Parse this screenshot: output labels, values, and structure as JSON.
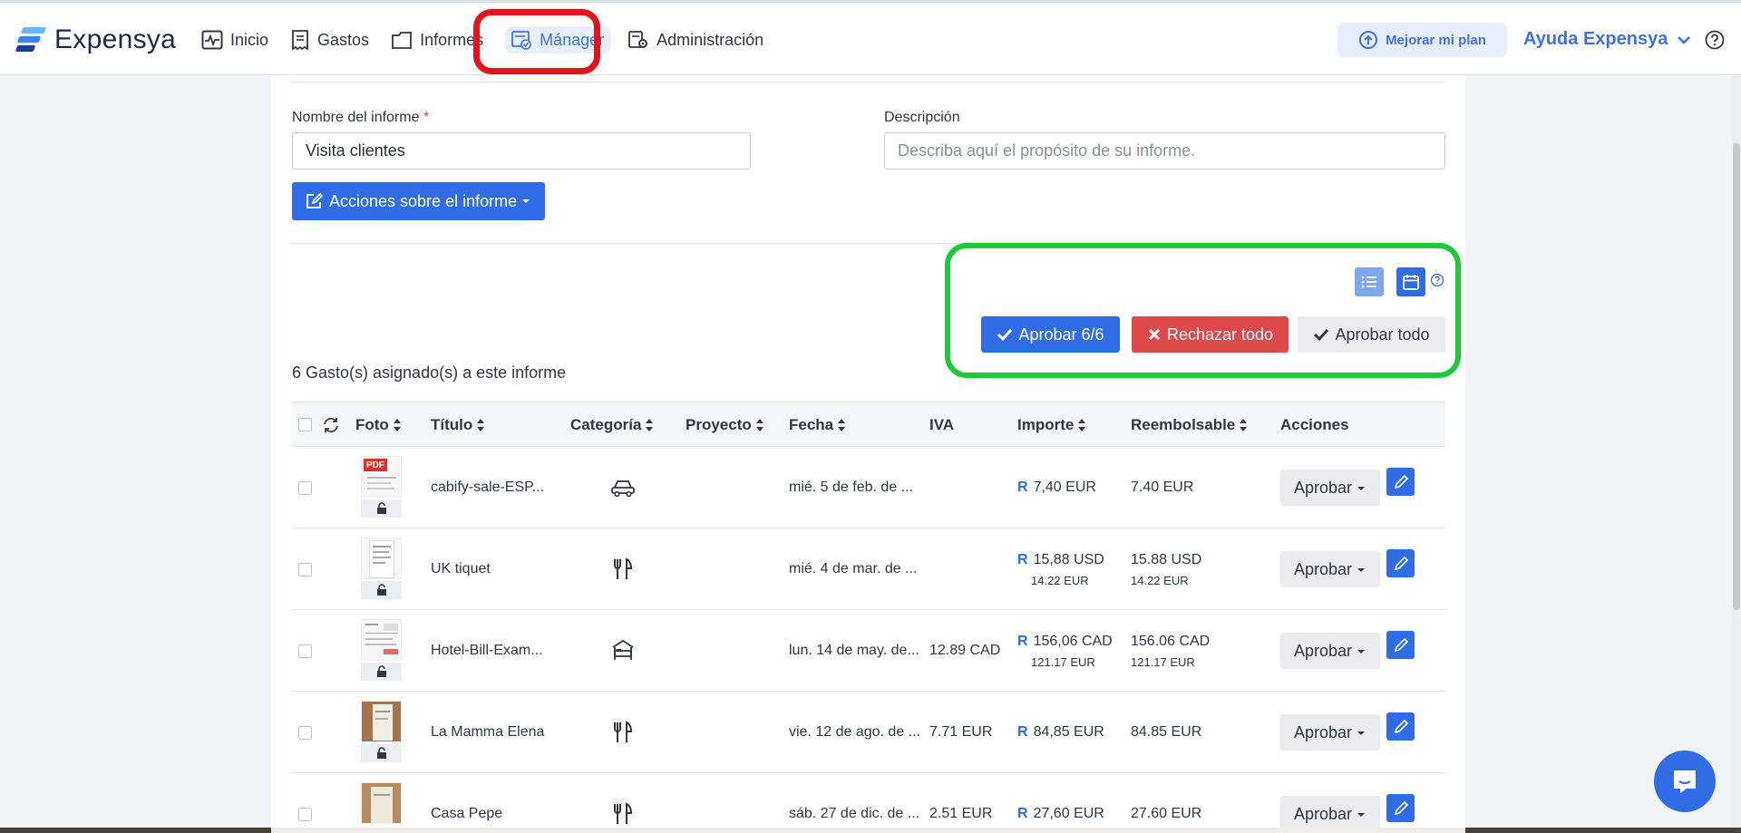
{
  "app": {
    "name": "Expensya",
    "brand_color": "#2f6ce6"
  },
  "nav": {
    "items": [
      {
        "label": "Inicio",
        "icon": "activity-icon"
      },
      {
        "label": "Gastos",
        "icon": "receipt-icon"
      },
      {
        "label": "Informes",
        "icon": "folder-icon"
      },
      {
        "label": "Mánager",
        "icon": "manager-icon",
        "active": true
      },
      {
        "label": "Administración",
        "icon": "admin-gear-icon"
      }
    ],
    "upgrade_label": "Mejorar mi plan",
    "help_label": "Ayuda Expensya"
  },
  "form": {
    "name_label": "Nombre del informe",
    "required_mark": "*",
    "name_value": "Visita clientes",
    "description_label": "Descripción",
    "description_placeholder": "Describa aquí el propósito de su informe.",
    "actions_label": "Acciones sobre el informe"
  },
  "bulk": {
    "approve_selected": "Aprobar 6/6",
    "reject_all": "Rechazar todo",
    "approve_all": "Aprobar todo"
  },
  "summary": {
    "count_text": "6 Gasto(s) asignado(s) a este informe"
  },
  "table": {
    "columns": [
      "Foto",
      "Título",
      "Categoría",
      "Proyecto",
      "Fecha",
      "IVA",
      "Importe",
      "Reembolsable",
      "Acciones"
    ],
    "rows": [
      {
        "title": "cabify-sale-ESP...",
        "category_icon": "car-icon",
        "date": "mié. 5 de feb. de ...",
        "iva": "",
        "amount": "7,40 EUR",
        "amount_sub": "",
        "refund": "7.40 EUR",
        "refund_sub": "",
        "thumb": "pdf",
        "action": "Aprobar"
      },
      {
        "title": "UK tiquet",
        "category_icon": "fork-knife-icon",
        "date": "mié. 4 de mar. de ...",
        "iva": "",
        "amount": "15,88 USD",
        "amount_sub": "14.22 EUR",
        "refund": "15.88 USD",
        "refund_sub": "14.22 EUR",
        "thumb": "receipt",
        "action": "Aprobar"
      },
      {
        "title": "Hotel-Bill-Exam...",
        "category_icon": "hotel-bed-icon",
        "date": "lun. 14 de may. de...",
        "iva": "12.89 CAD",
        "amount": "156,06 CAD",
        "amount_sub": "121.17 EUR",
        "refund": "156.06 CAD",
        "refund_sub": "121.17 EUR",
        "thumb": "document",
        "action": "Aprobar"
      },
      {
        "title": "La Mamma Elena",
        "category_icon": "fork-knife-icon",
        "date": "vie. 12 de ago. de ...",
        "iva": "7.71 EUR",
        "amount": "84,85 EUR",
        "amount_sub": "",
        "refund": "84.85 EUR",
        "refund_sub": "",
        "thumb": "photo-brown",
        "action": "Aprobar"
      },
      {
        "title": "Casa Pepe",
        "category_icon": "fork-knife-icon",
        "date": "sáb. 27 de dic. de ...",
        "iva": "2.51 EUR",
        "amount": "27,60 EUR",
        "amount_sub": "",
        "refund": "27.60 EUR",
        "refund_sub": "",
        "thumb": "photo-tan",
        "action": "Aprobar"
      }
    ]
  },
  "annotation_colors": {
    "red_box": "#e3141b",
    "green_box": "#1ec93a"
  }
}
